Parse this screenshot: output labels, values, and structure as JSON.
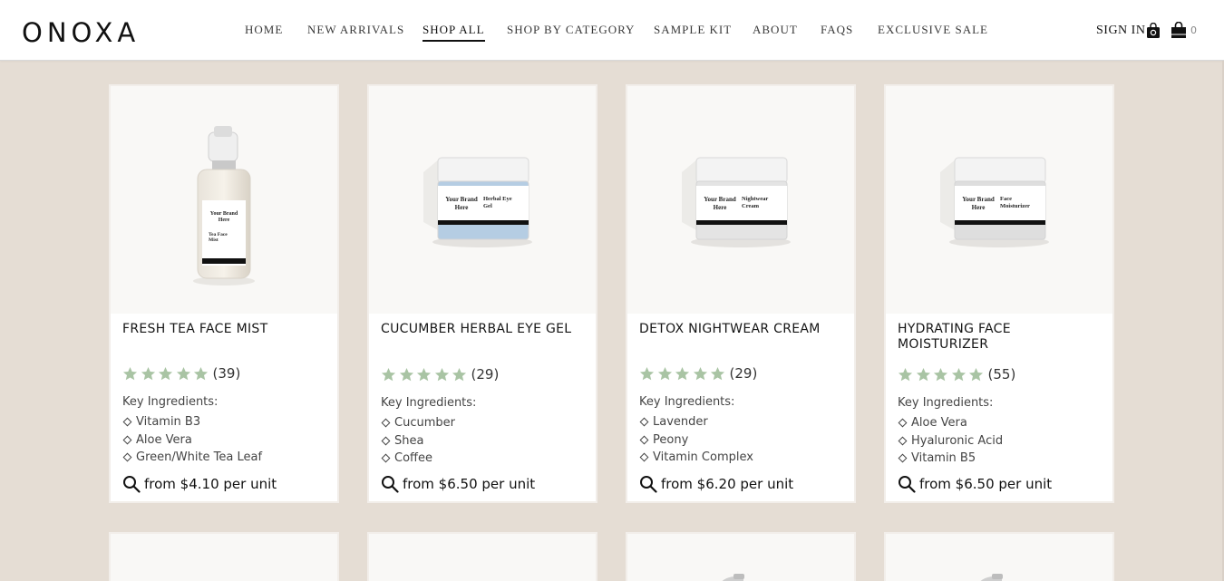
{
  "brand": {
    "logo": "ONOXA"
  },
  "nav": {
    "items": [
      {
        "label": "HOME",
        "active": false
      },
      {
        "label": "NEW ARRIVALS",
        "active": false
      },
      {
        "label": "SHOP ALL",
        "active": true
      },
      {
        "label": "SHOP BY CATEGORY",
        "active": false
      },
      {
        "label": "SAMPLE KIT",
        "active": false
      },
      {
        "label": "ABOUT",
        "active": false
      },
      {
        "label": "FAQS",
        "active": false
      },
      {
        "label": "EXCLUSIVE SALE",
        "active": false
      }
    ],
    "sign_in": "SIGN IN",
    "cart_count": "0"
  },
  "colors": {
    "accent_star": "#a9c4a4",
    "background": "#e5ddd4"
  },
  "products": [
    {
      "title": "FRESH TEA FACE MIST",
      "rating_count": "(39)",
      "stars": 5,
      "key_label": "Key Ingredients:",
      "ingredients": [
        "Vitamin B3",
        "Aloe Vera",
        "Green/White Tea Leaf"
      ],
      "price": "from $4.10 per unit",
      "image_icon": "mist-bottle-icon",
      "label_brand": "Your Brand Here",
      "label_name": "Tea Face Mist"
    },
    {
      "title": "CUCUMBER HERBAL EYE GEL",
      "rating_count": "(29)",
      "stars": 5,
      "key_label": "Key Ingredients:",
      "ingredients": [
        "Cucumber",
        "Shea",
        "Coffee"
      ],
      "price": "from $6.50 per unit",
      "image_icon": "jar-icon",
      "label_brand": "Your Brand Here",
      "label_name": "Herbal Eye Gel"
    },
    {
      "title": "DETOX NIGHTWEAR CREAM",
      "rating_count": "(29)",
      "stars": 5,
      "key_label": "Key Ingredients:",
      "ingredients": [
        "Lavender",
        "Peony",
        "Vitamin Complex"
      ],
      "price": "from $6.20 per unit",
      "image_icon": "jar-icon",
      "label_brand": "Your Brand Here",
      "label_name": "Nightwear Cream"
    },
    {
      "title": "HYDRATING FACE MOISTURIZER",
      "rating_count": "(55)",
      "stars": 5,
      "key_label": "Key Ingredients:",
      "ingredients": [
        "Aloe Vera",
        "Hyaluronic Acid",
        "Vitamin B5"
      ],
      "price": "from $6.50 per unit",
      "image_icon": "jar-icon",
      "label_brand": "Your Brand Here",
      "label_name": "Face Moisturizer"
    }
  ]
}
